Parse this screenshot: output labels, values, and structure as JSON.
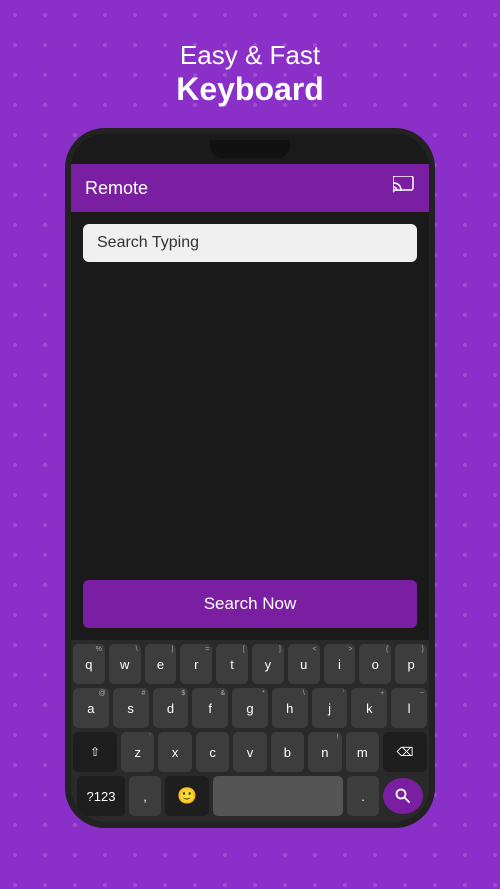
{
  "background": {
    "color": "#8B2FC9"
  },
  "header": {
    "line1": "Easy & Fast",
    "line2": "Keyboard"
  },
  "app": {
    "title": "Remote",
    "cast_icon": "⬛",
    "search_placeholder": "Search Typing",
    "search_button_label": "Search Now"
  },
  "keyboard": {
    "row1": [
      {
        "label": "q",
        "secondary": "%"
      },
      {
        "label": "w",
        "secondary": "\\"
      },
      {
        "label": "e",
        "secondary": "|"
      },
      {
        "label": "r",
        "secondary": "="
      },
      {
        "label": "t",
        "secondary": "["
      },
      {
        "label": "y",
        "secondary": "]"
      },
      {
        "label": "u",
        "secondary": "<"
      },
      {
        "label": "i",
        "secondary": ">"
      },
      {
        "label": "o",
        "secondary": "{"
      },
      {
        "label": "p",
        "secondary": "}"
      }
    ],
    "row2": [
      {
        "label": "a",
        "secondary": "@"
      },
      {
        "label": "s",
        "secondary": "#"
      },
      {
        "label": "d",
        "secondary": "$"
      },
      {
        "label": "f",
        "secondary": "&"
      },
      {
        "label": "g",
        "secondary": "*"
      },
      {
        "label": "h",
        "secondary": "\\"
      },
      {
        "label": "j",
        "secondary": "'"
      },
      {
        "label": "k",
        "secondary": "+"
      },
      {
        "label": "l",
        "secondary": "~"
      }
    ],
    "row3": [
      {
        "label": "z",
        "secondary": "`"
      },
      {
        "label": "x",
        "secondary": ""
      },
      {
        "label": "c",
        "secondary": ""
      },
      {
        "label": "v",
        "secondary": ""
      },
      {
        "label": "b",
        "secondary": ""
      },
      {
        "label": "n",
        "secondary": "!"
      },
      {
        "label": "m",
        "secondary": ""
      }
    ],
    "bottom": {
      "numbers_label": "?123",
      "comma": ",",
      "period": "."
    }
  }
}
